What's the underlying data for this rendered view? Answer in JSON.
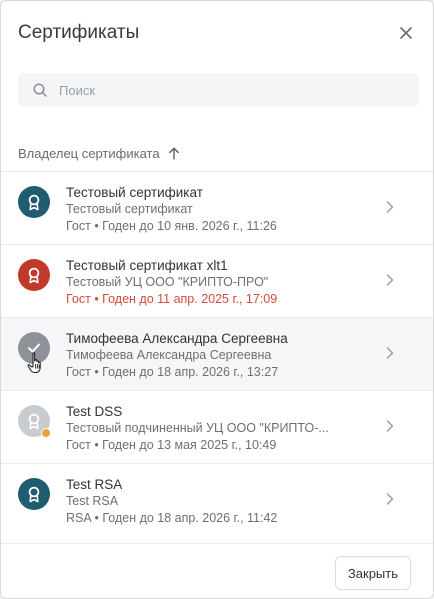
{
  "dialog": {
    "title": "Сертификаты",
    "close_icon": "close-icon",
    "search": {
      "placeholder": "Поиск",
      "value": "",
      "icon": "search-icon"
    },
    "sort": {
      "label": "Владелец сертификата",
      "direction": "ascending",
      "icon": "arrow-up-icon"
    },
    "certificates": [
      {
        "name": "Тестовый сертификат",
        "issuer": "Тестовый сертификат",
        "validity": "Гост • Годен до 10 янв. 2026 г., 11:26",
        "status": "valid",
        "avatar_color": "#1f5c70",
        "avatar_icon": "certificate-ribbon-icon"
      },
      {
        "name": "Тестовый сертификат xlt1",
        "issuer": "Тестовый УЦ ООО \"КРИПТО-ПРО\"",
        "validity": "Гост • Годен до 11 апр. 2025 г., 17:09",
        "status": "expired",
        "avatar_color": "#c0392b",
        "avatar_icon": "certificate-ribbon-icon"
      },
      {
        "name": "Тимофеева Александра Сергеевна",
        "issuer": "Тимофеева Александра Сергеевна",
        "validity": "Гост • Годен до 18 апр. 2026 г., 13:27",
        "status": "selected",
        "avatar_color": "#8e9298",
        "avatar_icon": "checkmark-icon"
      },
      {
        "name": "Test DSS",
        "issuer": "Тестовый подчиненный УЦ ООО \"КРИПТО-...",
        "validity": "Гост • Годен до 13 мая 2025 г., 10:49",
        "status": "warning",
        "avatar_color": "#c9cccf",
        "avatar_icon": "certificate-ribbon-icon"
      },
      {
        "name": "Test RSA",
        "issuer": "Test RSA",
        "validity": "RSA • Годен до 18 апр. 2026 г., 11:42",
        "status": "valid",
        "avatar_color": "#1f5c70",
        "avatar_icon": "certificate-ribbon-icon"
      }
    ],
    "footer": {
      "close_label": "Закрыть"
    },
    "colors": {
      "expired_text": "#d24b3a",
      "warning_badge": "#f0a236",
      "hover_row": "#f5f6f8"
    }
  }
}
